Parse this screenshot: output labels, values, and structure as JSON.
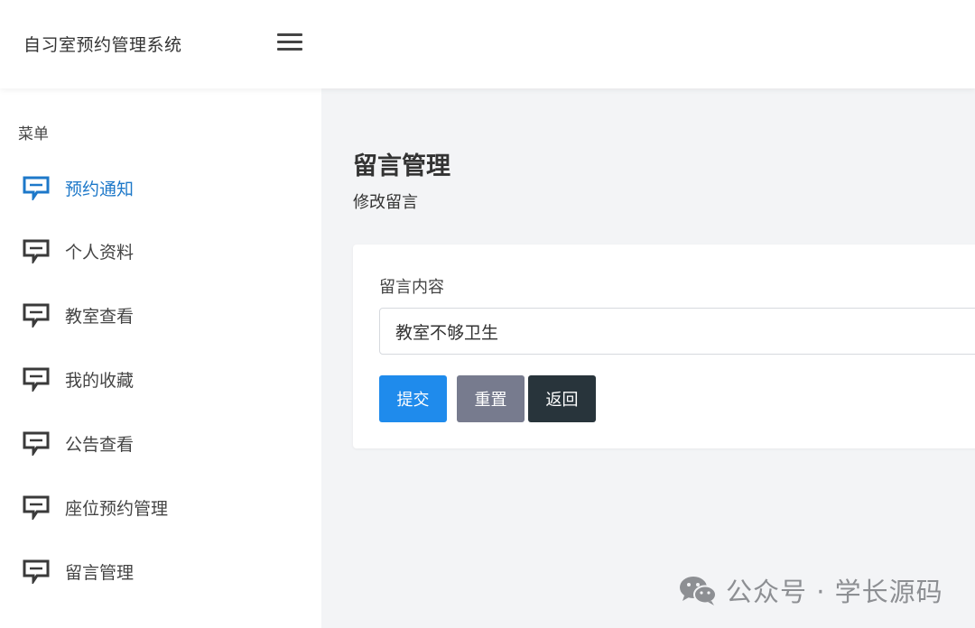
{
  "app": {
    "title": "自习室预约管理系统"
  },
  "sidebar": {
    "heading": "菜单",
    "items": [
      {
        "label": "预约通知",
        "icon": "chat-icon",
        "active": true
      },
      {
        "label": "个人资料",
        "icon": "chat-icon",
        "active": false
      },
      {
        "label": "教室查看",
        "icon": "chat-icon",
        "active": false
      },
      {
        "label": "我的收藏",
        "icon": "chat-icon",
        "active": false
      },
      {
        "label": "公告查看",
        "icon": "chat-icon",
        "active": false
      },
      {
        "label": "座位预约管理",
        "icon": "chat-icon",
        "active": false
      },
      {
        "label": "留言管理",
        "icon": "chat-icon",
        "active": false
      }
    ]
  },
  "main": {
    "title": "留言管理",
    "subtitle": "修改留言"
  },
  "form": {
    "content_label": "留言内容",
    "content_value": "教室不够卫生",
    "submit_label": "提交",
    "reset_label": "重置",
    "back_label": "返回"
  },
  "watermark": {
    "text": "公众号 · 学长源码",
    "icon": "wechat-icon"
  },
  "colors": {
    "accent": "#1d78c9",
    "submit": "#1f8bec",
    "reset": "#777b8e",
    "back": "#28343b",
    "background": "#f3f4f6"
  }
}
